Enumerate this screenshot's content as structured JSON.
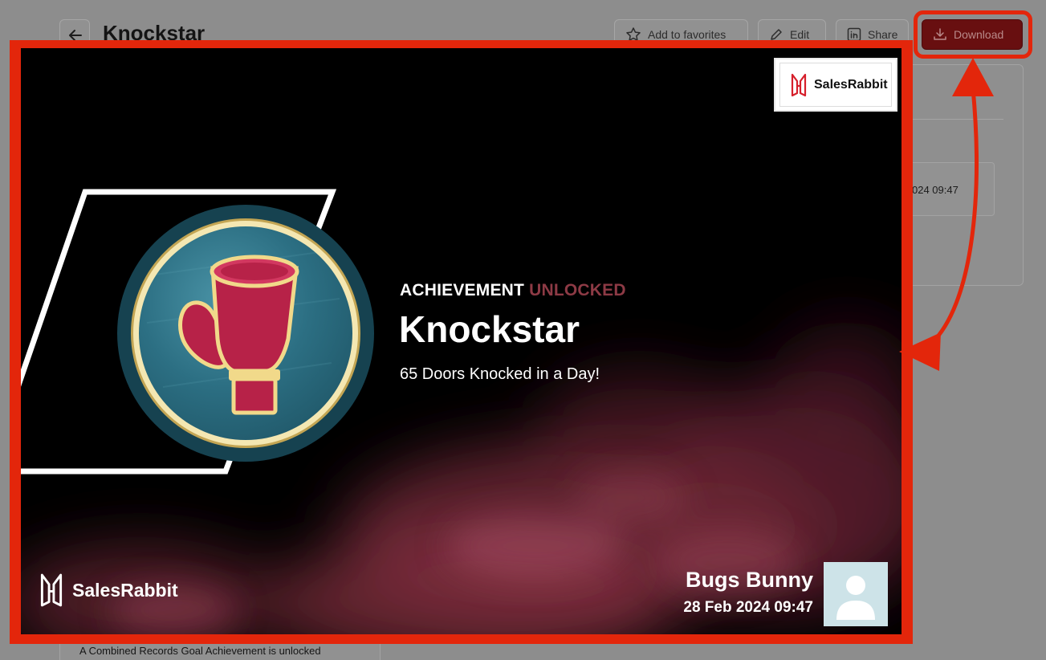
{
  "page": {
    "title": "Knockstar"
  },
  "toolbar": {
    "favorites_label": "Add to favorites",
    "edit_label": "Edit",
    "share_label": "Share",
    "download_label": "Download"
  },
  "side_panel": {
    "date_fragment": "024 09:47"
  },
  "bottom_card": {
    "description": "A Combined Records Goal Achievement is unlocked"
  },
  "achievement": {
    "label_prefix": "ACHIEVEMENT",
    "label_suffix": "UNLOCKED",
    "title": "Knockstar",
    "subtitle": "65 Doors Knocked in a Day!",
    "brand_name": "SalesRabbit",
    "footer_brand_name": "SalesRabbit",
    "user_name": "Bugs Bunny",
    "date": "28 Feb 2024 09:47",
    "badge_icon": "boxing-glove-icon"
  },
  "colors": {
    "highlight": "#e3260b",
    "download_button": "#680f10",
    "unlocked_text": "#8d3a45",
    "badge_ring": "#164250",
    "glove": "#b72248"
  }
}
